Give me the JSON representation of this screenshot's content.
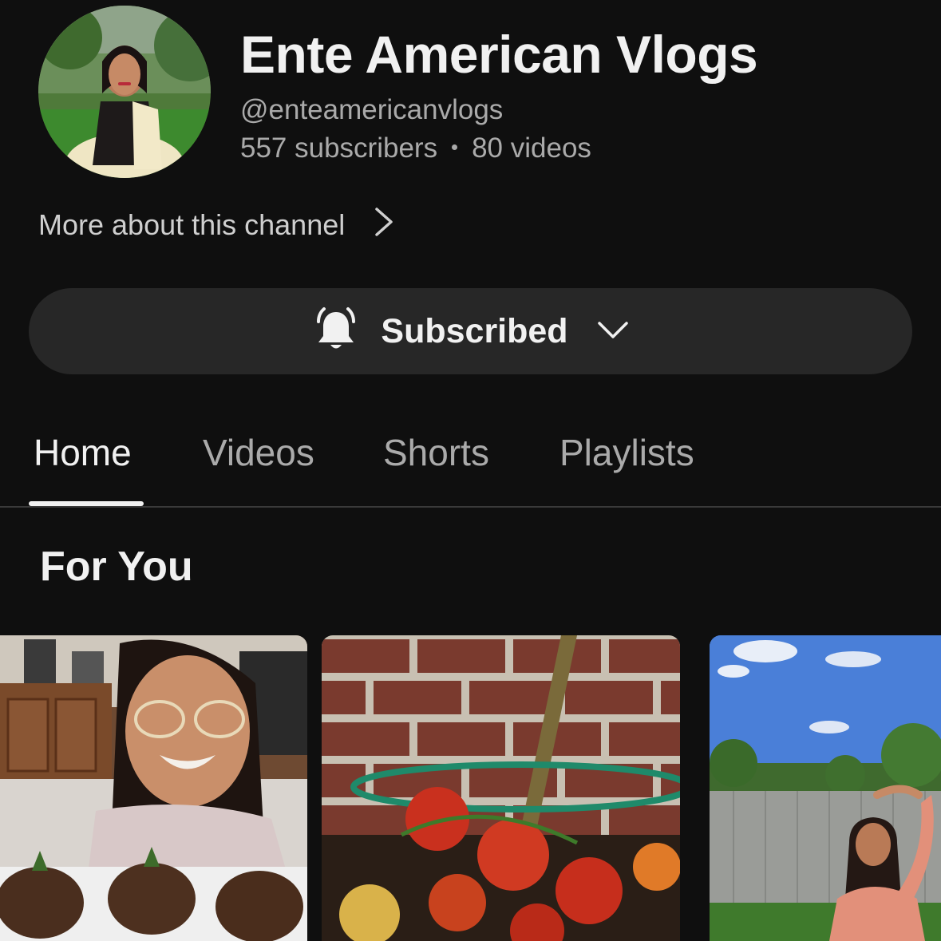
{
  "channel": {
    "name": "Ente American Vlogs",
    "handle": "@enteamericanvlogs",
    "subscribers": "557 subscribers",
    "videos": "80 videos",
    "more_about": "More about this channel"
  },
  "subscribe_button": {
    "label": "Subscribed",
    "bell_icon": "bell-ringing-icon",
    "caret_icon": "chevron-down-icon"
  },
  "tabs": [
    {
      "label": "Home",
      "active": true
    },
    {
      "label": "Videos",
      "active": false
    },
    {
      "label": "Shorts",
      "active": false
    },
    {
      "label": "Playlists",
      "active": false
    }
  ],
  "section": {
    "title": "For You"
  },
  "colors": {
    "background": "#0f0f0f",
    "button": "#272727",
    "text_primary": "#f1f1f1",
    "text_secondary": "#aaaaaa"
  }
}
